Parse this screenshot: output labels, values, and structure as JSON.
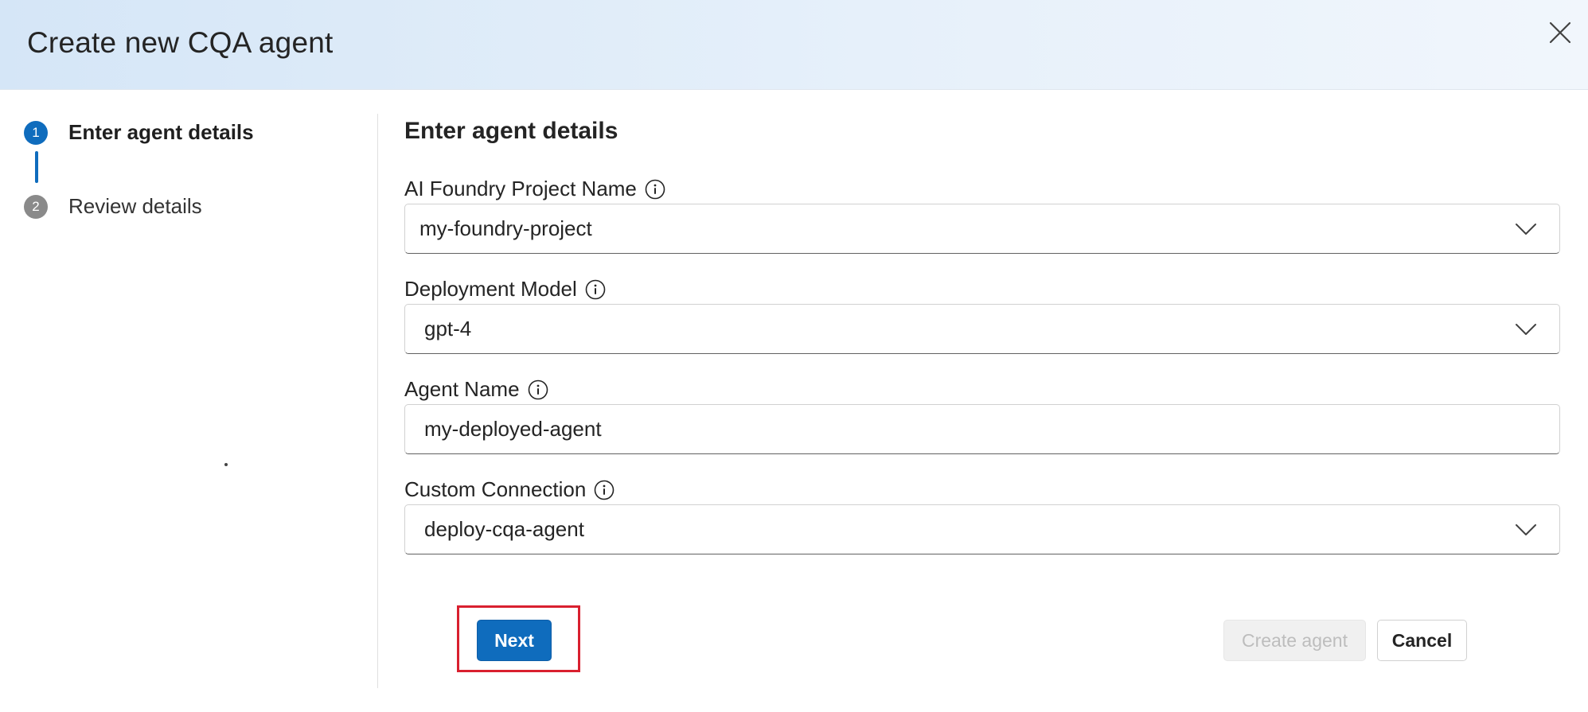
{
  "dialog": {
    "title": "Create new CQA agent",
    "close_icon": "close-icon"
  },
  "steps": [
    {
      "number": "1",
      "label": "Enter agent details",
      "state": "active"
    },
    {
      "number": "2",
      "label": "Review details",
      "state": "inactive"
    }
  ],
  "form": {
    "section_title": "Enter agent details",
    "project": {
      "label": "AI Foundry Project Name",
      "value": "my-foundry-project"
    },
    "model": {
      "label": "Deployment Model",
      "value": "gpt-4"
    },
    "agent_name": {
      "label": "Agent Name",
      "value": "my-deployed-agent"
    },
    "connection": {
      "label": "Custom Connection",
      "value": "deploy-cqa-agent"
    }
  },
  "buttons": {
    "next": "Next",
    "create_agent": "Create agent",
    "cancel": "Cancel"
  },
  "colors": {
    "accent": "#0f6cbd",
    "highlight": "#d9202f",
    "step_inactive": "#8a8a8a"
  }
}
